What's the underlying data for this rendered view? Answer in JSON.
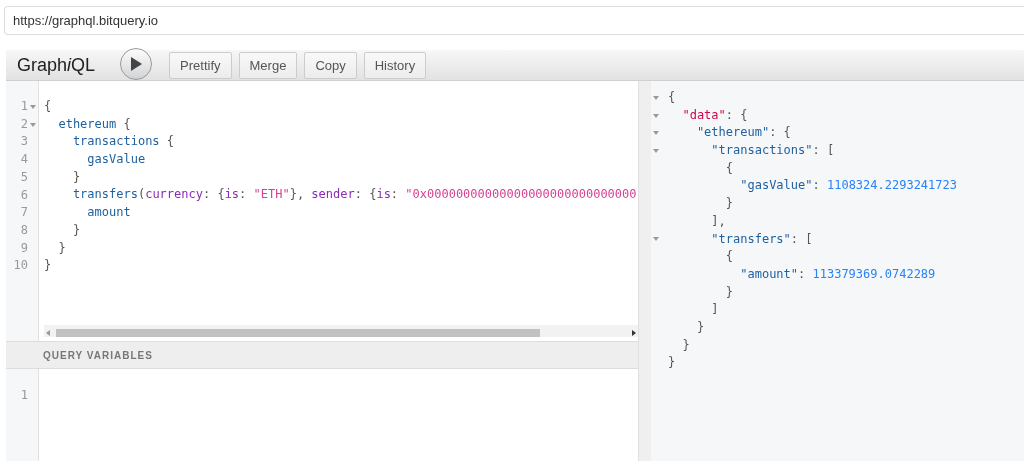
{
  "url": "https://graphql.bitquery.io",
  "toolbar": {
    "title": [
      {
        "text": "Graph",
        "italic": false
      },
      {
        "text": "i",
        "italic": true
      },
      {
        "text": "QL",
        "italic": false
      }
    ],
    "buttons": [
      "Prettify",
      "Merge",
      "Copy",
      "History"
    ]
  },
  "query_editor": {
    "lines": [
      {
        "number": "1",
        "foldable": true,
        "tokens": [
          {
            "kind": "punct",
            "text": "{"
          }
        ]
      },
      {
        "number": "2",
        "foldable": true,
        "tokens": [
          {
            "kind": "field",
            "text": "  ethereum"
          },
          {
            "kind": "punct",
            "text": " {"
          }
        ]
      },
      {
        "number": "3",
        "foldable": false,
        "tokens": [
          {
            "kind": "field",
            "text": "    transactions"
          },
          {
            "kind": "punct",
            "text": " {"
          }
        ]
      },
      {
        "number": "4",
        "foldable": false,
        "tokens": [
          {
            "kind": "field",
            "text": "      gasValue"
          }
        ]
      },
      {
        "number": "5",
        "foldable": false,
        "tokens": [
          {
            "kind": "punct",
            "text": "    }"
          }
        ]
      },
      {
        "number": "6",
        "foldable": false,
        "tokens": [
          {
            "kind": "field",
            "text": "    transfers"
          },
          {
            "kind": "punct",
            "text": "("
          },
          {
            "kind": "arg",
            "text": "currency"
          },
          {
            "kind": "punct",
            "text": ": {"
          },
          {
            "kind": "arg",
            "text": "is"
          },
          {
            "kind": "punct",
            "text": ": "
          },
          {
            "kind": "string",
            "text": "\"ETH\""
          },
          {
            "kind": "punct",
            "text": "}, "
          },
          {
            "kind": "arg",
            "text": "sender"
          },
          {
            "kind": "punct",
            "text": ": {"
          },
          {
            "kind": "arg",
            "text": "is"
          },
          {
            "kind": "punct",
            "text": ": "
          },
          {
            "kind": "string",
            "text": "\"0x00000000000000000000000000000"
          }
        ]
      },
      {
        "number": "7",
        "foldable": false,
        "tokens": [
          {
            "kind": "field",
            "text": "      amount"
          }
        ]
      },
      {
        "number": "8",
        "foldable": false,
        "tokens": [
          {
            "kind": "punct",
            "text": "    }"
          }
        ]
      },
      {
        "number": "9",
        "foldable": false,
        "tokens": [
          {
            "kind": "punct",
            "text": "  }"
          }
        ]
      },
      {
        "number": "10",
        "foldable": false,
        "tokens": [
          {
            "kind": "punct",
            "text": "}"
          }
        ]
      }
    ]
  },
  "variables": {
    "title": "QUERY VARIABLES",
    "lines": [
      {
        "number": "1"
      }
    ]
  },
  "result": {
    "lines": [
      {
        "foldable": true,
        "tokens": [
          {
            "kind": "punct",
            "text": "{"
          }
        ]
      },
      {
        "foldable": true,
        "tokens": [
          {
            "kind": "datakey",
            "text": "  \"data\""
          },
          {
            "kind": "punct",
            "text": ": {"
          }
        ]
      },
      {
        "foldable": true,
        "tokens": [
          {
            "kind": "field",
            "text": "    \"ethereum\""
          },
          {
            "kind": "punct",
            "text": ": {"
          }
        ]
      },
      {
        "foldable": true,
        "tokens": [
          {
            "kind": "field",
            "text": "      \"transactions\""
          },
          {
            "kind": "punct",
            "text": ": ["
          }
        ]
      },
      {
        "foldable": false,
        "tokens": [
          {
            "kind": "punct",
            "text": "        {"
          }
        ]
      },
      {
        "foldable": false,
        "tokens": [
          {
            "kind": "field",
            "text": "          \"gasValue\""
          },
          {
            "kind": "punct",
            "text": ": "
          },
          {
            "kind": "number",
            "text": "1108324.2293241723"
          }
        ]
      },
      {
        "foldable": false,
        "tokens": [
          {
            "kind": "punct",
            "text": "        }"
          }
        ]
      },
      {
        "foldable": false,
        "tokens": [
          {
            "kind": "punct",
            "text": "      ],"
          }
        ]
      },
      {
        "foldable": true,
        "tokens": [
          {
            "kind": "field",
            "text": "      \"transfers\""
          },
          {
            "kind": "punct",
            "text": ": ["
          }
        ]
      },
      {
        "foldable": false,
        "tokens": [
          {
            "kind": "punct",
            "text": "        {"
          }
        ]
      },
      {
        "foldable": false,
        "tokens": [
          {
            "kind": "field",
            "text": "          \"amount\""
          },
          {
            "kind": "punct",
            "text": ": "
          },
          {
            "kind": "number",
            "text": "113379369.0742289"
          }
        ]
      },
      {
        "foldable": false,
        "tokens": [
          {
            "kind": "punct",
            "text": "        }"
          }
        ]
      },
      {
        "foldable": false,
        "tokens": [
          {
            "kind": "punct",
            "text": "      ]"
          }
        ]
      },
      {
        "foldable": false,
        "tokens": [
          {
            "kind": "punct",
            "text": "    }"
          }
        ]
      },
      {
        "foldable": false,
        "tokens": [
          {
            "kind": "punct",
            "text": "  }"
          }
        ]
      },
      {
        "foldable": false,
        "tokens": [
          {
            "kind": "punct",
            "text": "}"
          }
        ]
      }
    ]
  }
}
